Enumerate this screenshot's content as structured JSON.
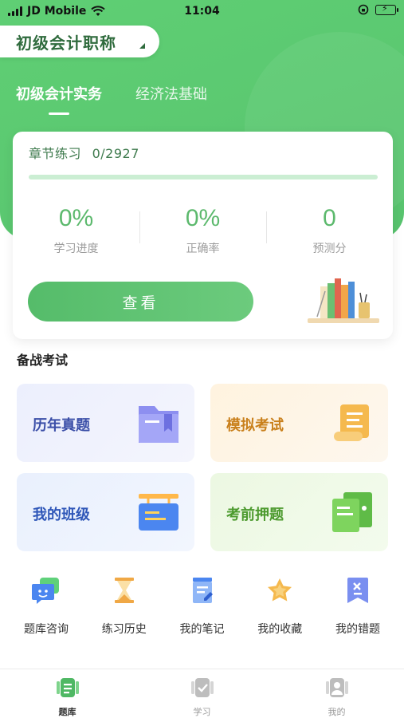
{
  "status_bar": {
    "carrier": "JD Mobile",
    "time": "11:04"
  },
  "subject": {
    "title": "初级会计职称"
  },
  "tabs": [
    {
      "label": "初级会计实务",
      "active": true
    },
    {
      "label": "经济法基础",
      "active": false
    }
  ],
  "practice_card": {
    "chapter_label": "章节练习",
    "chapter_count": "0/2927",
    "progress_fraction": 0,
    "stats": [
      {
        "value": "0%",
        "label": "学习进度"
      },
      {
        "value": "0%",
        "label": "正确率"
      },
      {
        "value": "0",
        "label": "预测分"
      }
    ],
    "button_label": "查看"
  },
  "exam_section": {
    "title": "备战考试",
    "cards": [
      {
        "label": "历年真题",
        "icon": "folder-icon"
      },
      {
        "label": "模拟考试",
        "icon": "scroll-icon"
      },
      {
        "label": "我的班级",
        "icon": "signboard-icon"
      },
      {
        "label": "考前押题",
        "icon": "documents-icon"
      }
    ]
  },
  "shortcuts": [
    {
      "label": "题库咨询",
      "icon": "chat-icon"
    },
    {
      "label": "练习历史",
      "icon": "hourglass-icon"
    },
    {
      "label": "我的笔记",
      "icon": "notes-icon"
    },
    {
      "label": "我的收藏",
      "icon": "star-icon"
    },
    {
      "label": "我的错题",
      "icon": "wrong-bookmark-icon"
    }
  ],
  "bottom_nav": [
    {
      "label": "题库",
      "active": true
    },
    {
      "label": "学习",
      "active": false
    },
    {
      "label": "我的",
      "active": false
    }
  ],
  "colors": {
    "brand_green": "#5dc46f",
    "exam_blue": "#3b4fa8",
    "exam_orange": "#c9801c",
    "exam_green": "#4c9a2e"
  }
}
